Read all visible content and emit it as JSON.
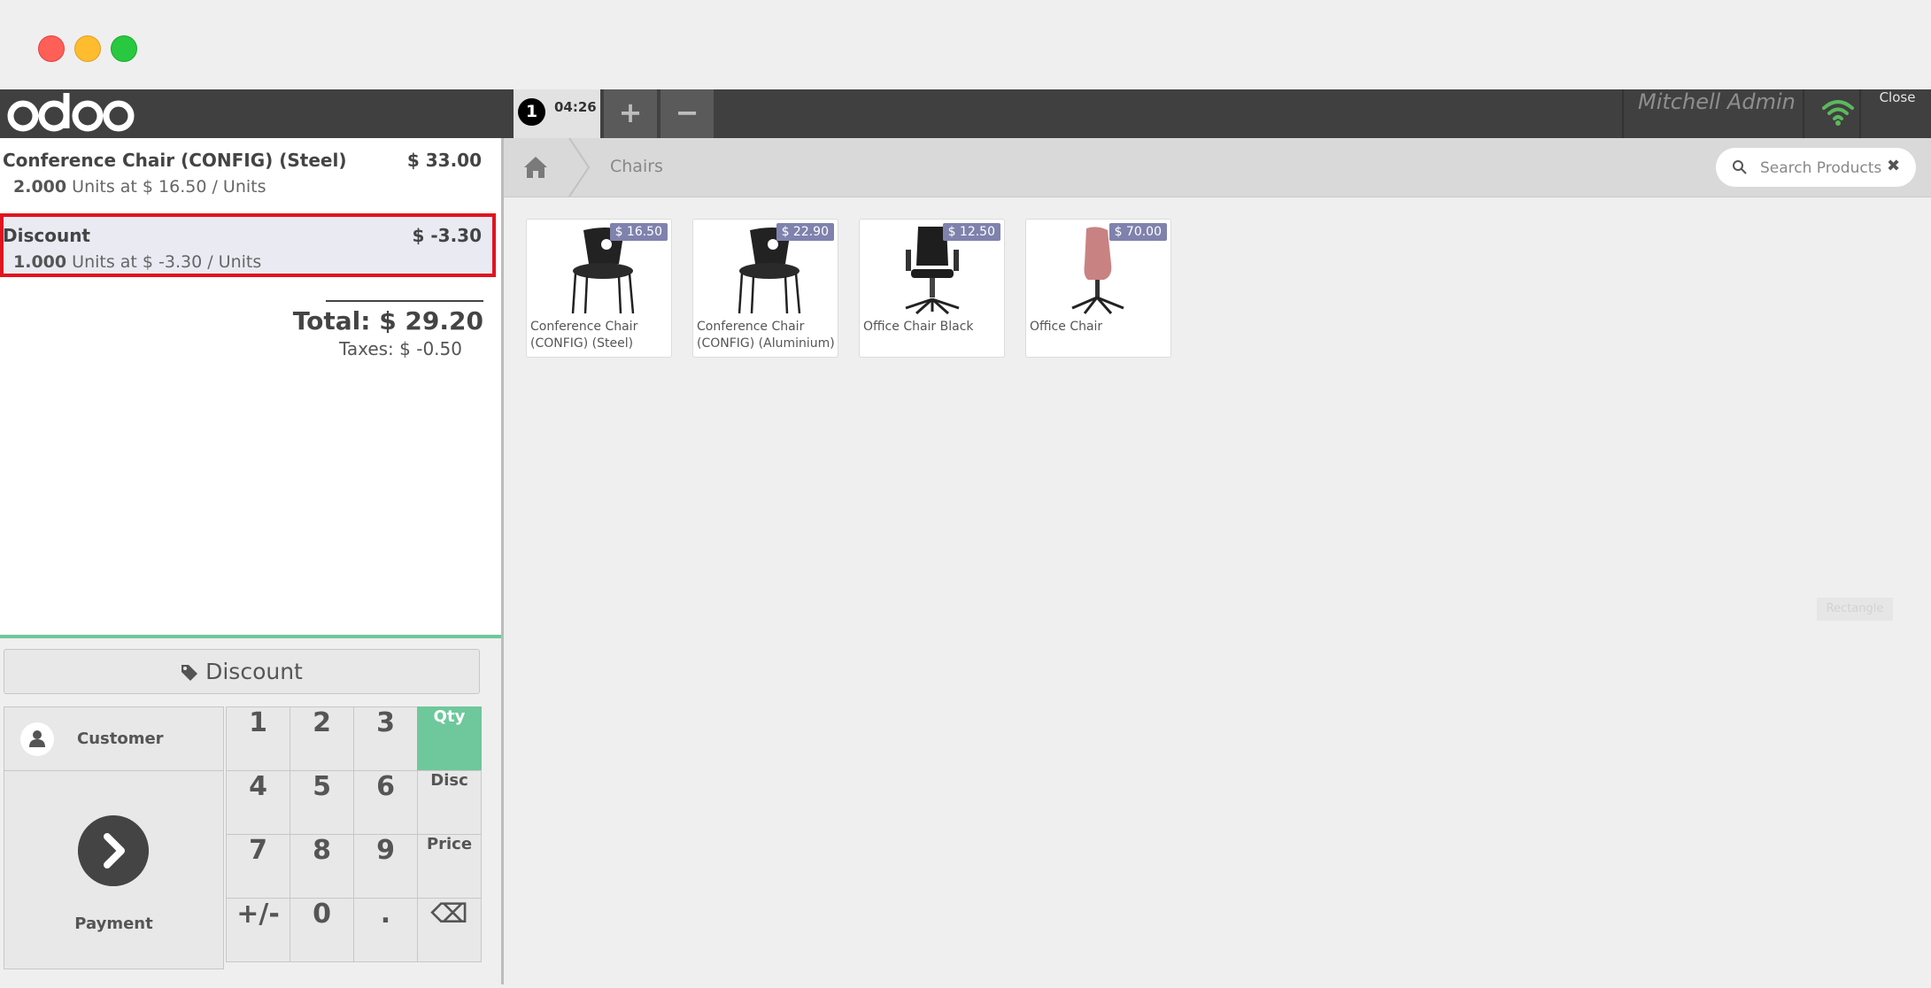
{
  "window": {
    "controls": [
      "close",
      "minimize",
      "maximize"
    ]
  },
  "topbar": {
    "logo": "odoo",
    "order": {
      "number": "1",
      "time": "04:26"
    },
    "add_label": "+",
    "remove_label": "−",
    "user": "Mitchell Admin",
    "close_label": "Close",
    "wifi_color": "#5cb85c"
  },
  "order": {
    "lines": [
      {
        "name": "Conference Chair (CONFIG) (Steel)",
        "price": "$ 33.00",
        "qty": "2.000",
        "detail": "Units at $ 16.50 / Units"
      },
      {
        "name": "Discount",
        "price": "$ -3.30",
        "qty": "1.000",
        "detail": "Units at $ -3.30 / Units",
        "selected": true
      }
    ],
    "total": "Total: $ 29.20",
    "taxes": "Taxes: $ -0.50"
  },
  "controls": {
    "discount_label": "Discount",
    "customer_label": "Customer",
    "payment_label": "Payment",
    "keys": [
      "1",
      "2",
      "3",
      "Qty",
      "4",
      "5",
      "6",
      "Disc",
      "7",
      "8",
      "9",
      "Price",
      "+/-",
      "0",
      ".",
      "⌫"
    ],
    "active_mode": "Qty",
    "accent": "#6ec89b"
  },
  "products_screen": {
    "breadcrumb": "Chairs",
    "search_placeholder": "Search Products",
    "clear_label": "✖",
    "ghost_label": "Rectangle",
    "products": [
      {
        "name": "Conference Chair (CONFIG) (Steel)",
        "price": "$ 16.50"
      },
      {
        "name": "Conference Chair (CONFIG) (Aluminium)",
        "price": "$ 22.90"
      },
      {
        "name": "Office Chair Black",
        "price": "$ 12.50"
      },
      {
        "name": "Office Chair",
        "price": "$ 70.00"
      }
    ],
    "badge_color": "#7f82ac"
  }
}
